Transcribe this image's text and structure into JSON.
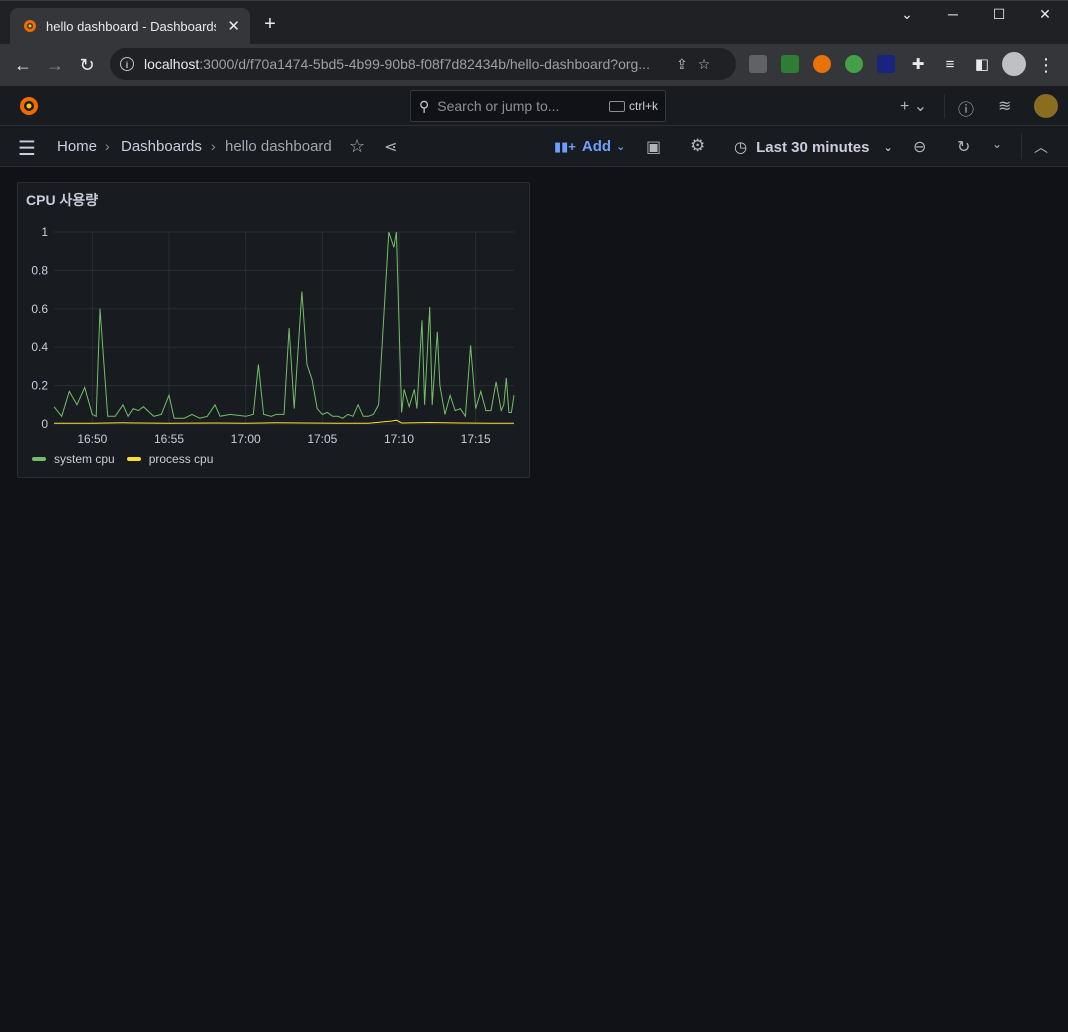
{
  "browser": {
    "tab_title": "hello dashboard - Dashboards - Grafana",
    "url_host": "localhost",
    "url_rest": ":3000/d/f70a1474-5bd5-4b99-90b8-f08f7d82434b/hello-dashboard?org..."
  },
  "grafana": {
    "search_placeholder": "Search or jump to...",
    "search_shortcut": "ctrl+k",
    "breadcrumbs": [
      "Home",
      "Dashboards",
      "hello dashboard"
    ],
    "add_label": "Add",
    "time_range": "Last 30 minutes"
  },
  "panel": {
    "title": "CPU 사용량"
  },
  "chart_data": {
    "type": "line",
    "title": "CPU 사용량",
    "ylim": [
      0,
      1
    ],
    "y_ticks": [
      "0",
      "0.2",
      "0.4",
      "0.6",
      "0.8",
      "1"
    ],
    "x_tick_labels": [
      "16:50",
      "16:55",
      "17:00",
      "17:05",
      "17:10",
      "17:15"
    ],
    "x_start": "16:47:30",
    "x_end": "17:17:30",
    "series": [
      {
        "name": "system cpu",
        "color": "#73bf69",
        "points": [
          [
            "16:47:30",
            0.09
          ],
          [
            "16:48:00",
            0.04
          ],
          [
            "16:48:30",
            0.17
          ],
          [
            "16:49:00",
            0.1
          ],
          [
            "16:49:30",
            0.19
          ],
          [
            "16:50:00",
            0.05
          ],
          [
            "16:50:15",
            0.04
          ],
          [
            "16:50:30",
            0.6
          ],
          [
            "16:51:00",
            0.04
          ],
          [
            "16:51:30",
            0.04
          ],
          [
            "16:52:00",
            0.1
          ],
          [
            "16:52:20",
            0.04
          ],
          [
            "16:52:40",
            0.08
          ],
          [
            "16:53:00",
            0.07
          ],
          [
            "16:53:20",
            0.09
          ],
          [
            "16:54:00",
            0.04
          ],
          [
            "16:54:30",
            0.05
          ],
          [
            "16:55:00",
            0.15
          ],
          [
            "16:55:20",
            0.03
          ],
          [
            "16:56:00",
            0.03
          ],
          [
            "16:56:30",
            0.05
          ],
          [
            "16:57:00",
            0.03
          ],
          [
            "16:57:30",
            0.04
          ],
          [
            "16:58:00",
            0.1
          ],
          [
            "16:58:20",
            0.04
          ],
          [
            "16:59:00",
            0.05
          ],
          [
            "17:00:00",
            0.04
          ],
          [
            "17:00:30",
            0.05
          ],
          [
            "17:00:50",
            0.31
          ],
          [
            "17:01:10",
            0.05
          ],
          [
            "17:01:40",
            0.04
          ],
          [
            "17:02:00",
            0.05
          ],
          [
            "17:02:30",
            0.05
          ],
          [
            "17:02:50",
            0.5
          ],
          [
            "17:03:10",
            0.08
          ],
          [
            "17:03:40",
            0.69
          ],
          [
            "17:04:00",
            0.31
          ],
          [
            "17:04:20",
            0.23
          ],
          [
            "17:04:40",
            0.08
          ],
          [
            "17:05:00",
            0.05
          ],
          [
            "17:05:20",
            0.06
          ],
          [
            "17:05:40",
            0.04
          ],
          [
            "17:06:00",
            0.04
          ],
          [
            "17:06:20",
            0.03
          ],
          [
            "17:06:40",
            0.05
          ],
          [
            "17:07:00",
            0.04
          ],
          [
            "17:07:20",
            0.1
          ],
          [
            "17:07:40",
            0.04
          ],
          [
            "17:08:00",
            0.04
          ],
          [
            "17:08:20",
            0.05
          ],
          [
            "17:08:40",
            0.1
          ],
          [
            "17:09:00",
            0.55
          ],
          [
            "17:09:20",
            1.0
          ],
          [
            "17:09:40",
            0.92
          ],
          [
            "17:09:50",
            1.0
          ],
          [
            "17:10:10",
            0.06
          ],
          [
            "17:10:20",
            0.18
          ],
          [
            "17:10:40",
            0.09
          ],
          [
            "17:11:00",
            0.18
          ],
          [
            "17:11:10",
            0.08
          ],
          [
            "17:11:30",
            0.54
          ],
          [
            "17:11:40",
            0.1
          ],
          [
            "17:12:00",
            0.61
          ],
          [
            "17:12:10",
            0.1
          ],
          [
            "17:12:30",
            0.48
          ],
          [
            "17:12:40",
            0.2
          ],
          [
            "17:13:00",
            0.05
          ],
          [
            "17:13:20",
            0.15
          ],
          [
            "17:13:40",
            0.07
          ],
          [
            "17:14:00",
            0.08
          ],
          [
            "17:14:20",
            0.04
          ],
          [
            "17:14:40",
            0.41
          ],
          [
            "17:15:00",
            0.08
          ],
          [
            "17:15:20",
            0.17
          ],
          [
            "17:15:40",
            0.07
          ],
          [
            "17:16:00",
            0.07
          ],
          [
            "17:16:20",
            0.22
          ],
          [
            "17:16:40",
            0.07
          ],
          [
            "17:16:50",
            0.1
          ],
          [
            "17:17:00",
            0.24
          ],
          [
            "17:17:10",
            0.06
          ],
          [
            "17:17:20",
            0.06
          ],
          [
            "17:17:30",
            0.15
          ]
        ]
      },
      {
        "name": "process cpu",
        "color": "#fade2a",
        "points": [
          [
            "16:47:30",
            0.004
          ],
          [
            "16:50:00",
            0.004
          ],
          [
            "16:52:00",
            0.006
          ],
          [
            "16:55:00",
            0.004
          ],
          [
            "16:58:00",
            0.005
          ],
          [
            "17:00:00",
            0.004
          ],
          [
            "17:02:00",
            0.006
          ],
          [
            "17:04:00",
            0.005
          ],
          [
            "17:06:00",
            0.004
          ],
          [
            "17:08:00",
            0.004
          ],
          [
            "17:09:30",
            0.015
          ],
          [
            "17:09:50",
            0.02
          ],
          [
            "17:10:10",
            0.005
          ],
          [
            "17:12:00",
            0.008
          ],
          [
            "17:14:00",
            0.005
          ],
          [
            "17:16:00",
            0.004
          ],
          [
            "17:17:30",
            0.004
          ]
        ]
      }
    ],
    "legend": [
      "system cpu",
      "process cpu"
    ],
    "grid": true
  }
}
